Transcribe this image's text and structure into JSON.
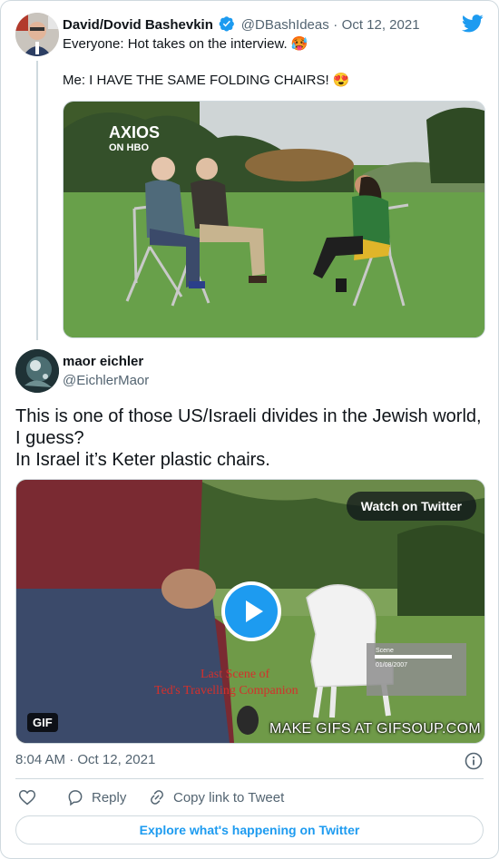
{
  "quoted_tweet": {
    "author_name": "David/Dovid Bashevkin",
    "handle": "@DBashIdeas",
    "separator": "·",
    "date": "Oct 12, 2021",
    "line1": "Everyone: Hot takes on the interview.",
    "line1_emoji": "🥵",
    "line2": "Me: I HAVE THE SAME FOLDING CHAIRS!",
    "line2_emoji": "😍",
    "media_logo_main": "AXIOS",
    "media_logo_sub": "ON HBO"
  },
  "reply_tweet": {
    "author_name": "maor eichler",
    "handle": "@EichlerMaor",
    "text_line1": "This is one of those US/Israeli divides in the Jewish world,",
    "text_line2": "I guess?",
    "text_line3": "In Israel it’s Keter plastic chairs.",
    "media": {
      "watch_label": "Watch on Twitter",
      "gif_badge": "GIF",
      "caption_line1": "Last Scene of",
      "caption_line2": "Ted's Travelling Companion",
      "overlay_line1": "Scene",
      "overlay_line2": "01/08/2007",
      "watermark": "MAKE GIFS AT GIFSOUP.COM"
    },
    "time": "8:04 AM",
    "separator": "·",
    "date": "Oct 12, 2021"
  },
  "actions": {
    "reply_label": "Reply",
    "copy_link_label": "Copy link to Tweet"
  },
  "explore_label": "Explore what's happening on Twitter",
  "colors": {
    "twitter_blue": "#1d9bf0",
    "text_primary": "#0f1419",
    "text_secondary": "#536471",
    "border": "#cfd9de"
  }
}
